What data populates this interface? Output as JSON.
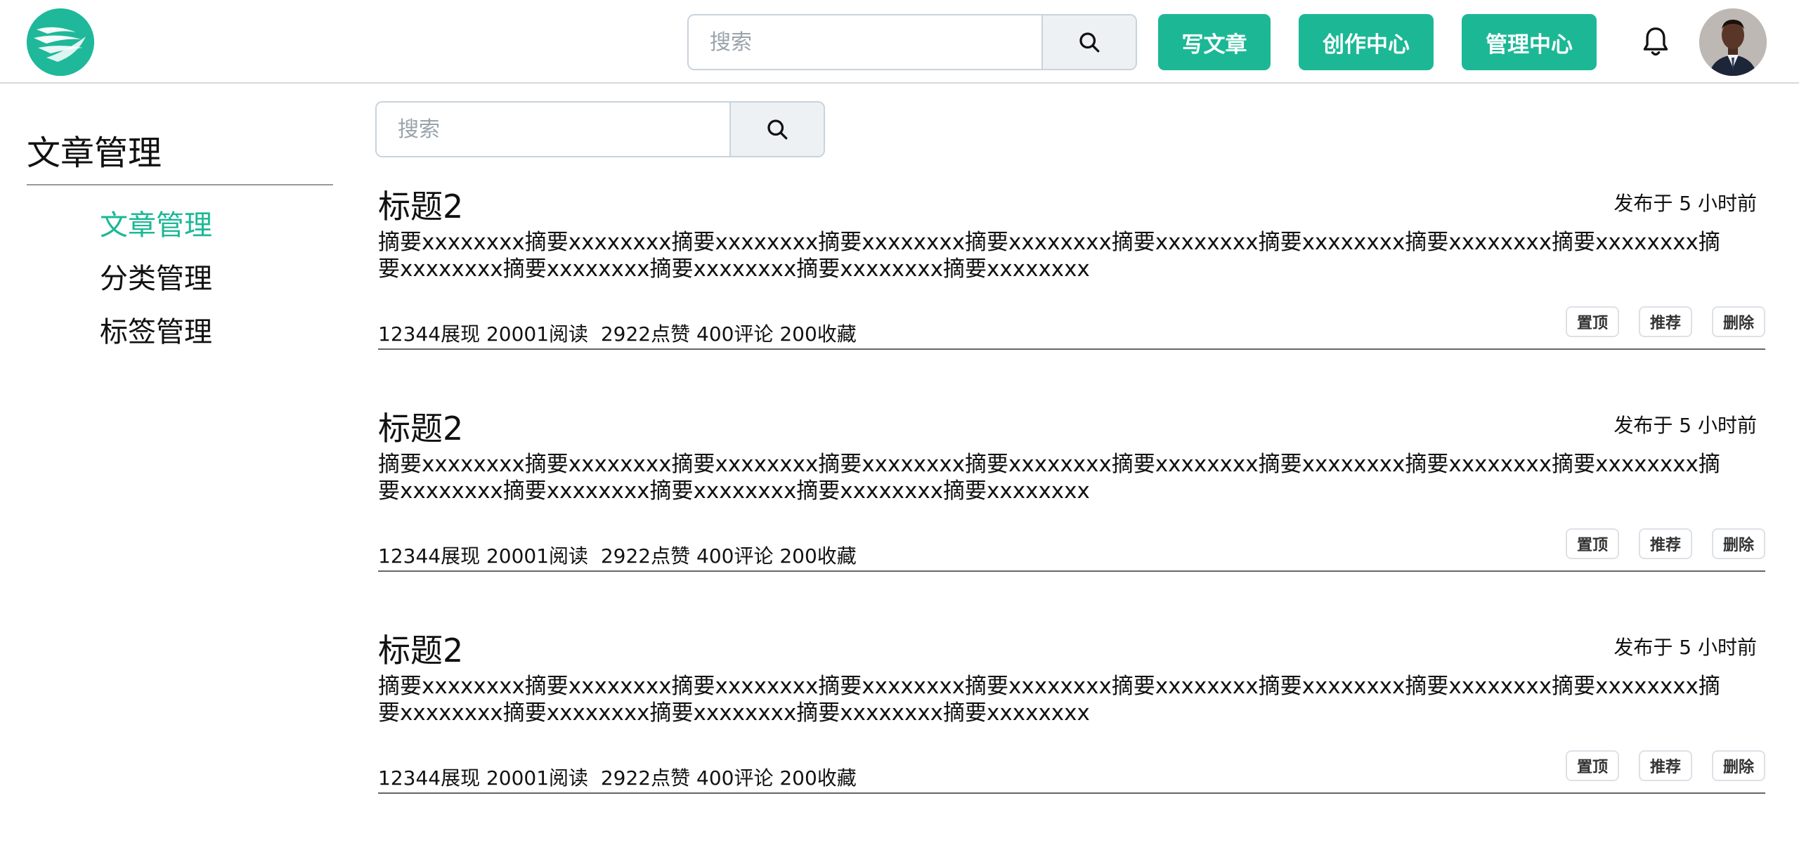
{
  "header": {
    "search_placeholder": "搜索",
    "write_label": "写文章",
    "create_label": "创作中心",
    "manage_label": "管理中心"
  },
  "colors": {
    "brand": "#1cb896",
    "active_nav": "#1cb896"
  },
  "sidebar": {
    "title": "文章管理",
    "items": [
      {
        "label": "文章管理",
        "active": true
      },
      {
        "label": "分类管理",
        "active": false
      },
      {
        "label": "标签管理",
        "active": false
      }
    ]
  },
  "content": {
    "search_placeholder": "搜索",
    "articles": [
      {
        "title": "标题2",
        "time": "发布于 5 小时前",
        "summary": "摘要xxxxxxxx摘要xxxxxxxx摘要xxxxxxxx摘要xxxxxxxx摘要xxxxxxxx摘要xxxxxxxx摘要xxxxxxxx摘要xxxxxxxx摘要xxxxxxxx摘要xxxxxxxx摘要xxxxxxxx摘要xxxxxxxx摘要xxxxxxxx摘要xxxxxxxx",
        "stats": "12344展现 20001阅读  2922点赞 400评论 200收藏",
        "actions": [
          "置顶",
          "推荐",
          "删除"
        ]
      },
      {
        "title": "标题2",
        "time": "发布于 5 小时前",
        "summary": "摘要xxxxxxxx摘要xxxxxxxx摘要xxxxxxxx摘要xxxxxxxx摘要xxxxxxxx摘要xxxxxxxx摘要xxxxxxxx摘要xxxxxxxx摘要xxxxxxxx摘要xxxxxxxx摘要xxxxxxxx摘要xxxxxxxx摘要xxxxxxxx摘要xxxxxxxx",
        "stats": "12344展现 20001阅读  2922点赞 400评论 200收藏",
        "actions": [
          "置顶",
          "推荐",
          "删除"
        ]
      },
      {
        "title": "标题2",
        "time": "发布于 5 小时前",
        "summary": "摘要xxxxxxxx摘要xxxxxxxx摘要xxxxxxxx摘要xxxxxxxx摘要xxxxxxxx摘要xxxxxxxx摘要xxxxxxxx摘要xxxxxxxx摘要xxxxxxxx摘要xxxxxxxx摘要xxxxxxxx摘要xxxxxxxx摘要xxxxxxxx摘要xxxxxxxx",
        "stats": "12344展现 20001阅读  2922点赞 400评论 200收藏",
        "actions": [
          "置顶",
          "推荐",
          "删除"
        ]
      }
    ]
  },
  "icons": {
    "logo": "bird-logo-icon",
    "search": "search-icon",
    "bell": "bell-icon",
    "avatar": "user-avatar"
  }
}
